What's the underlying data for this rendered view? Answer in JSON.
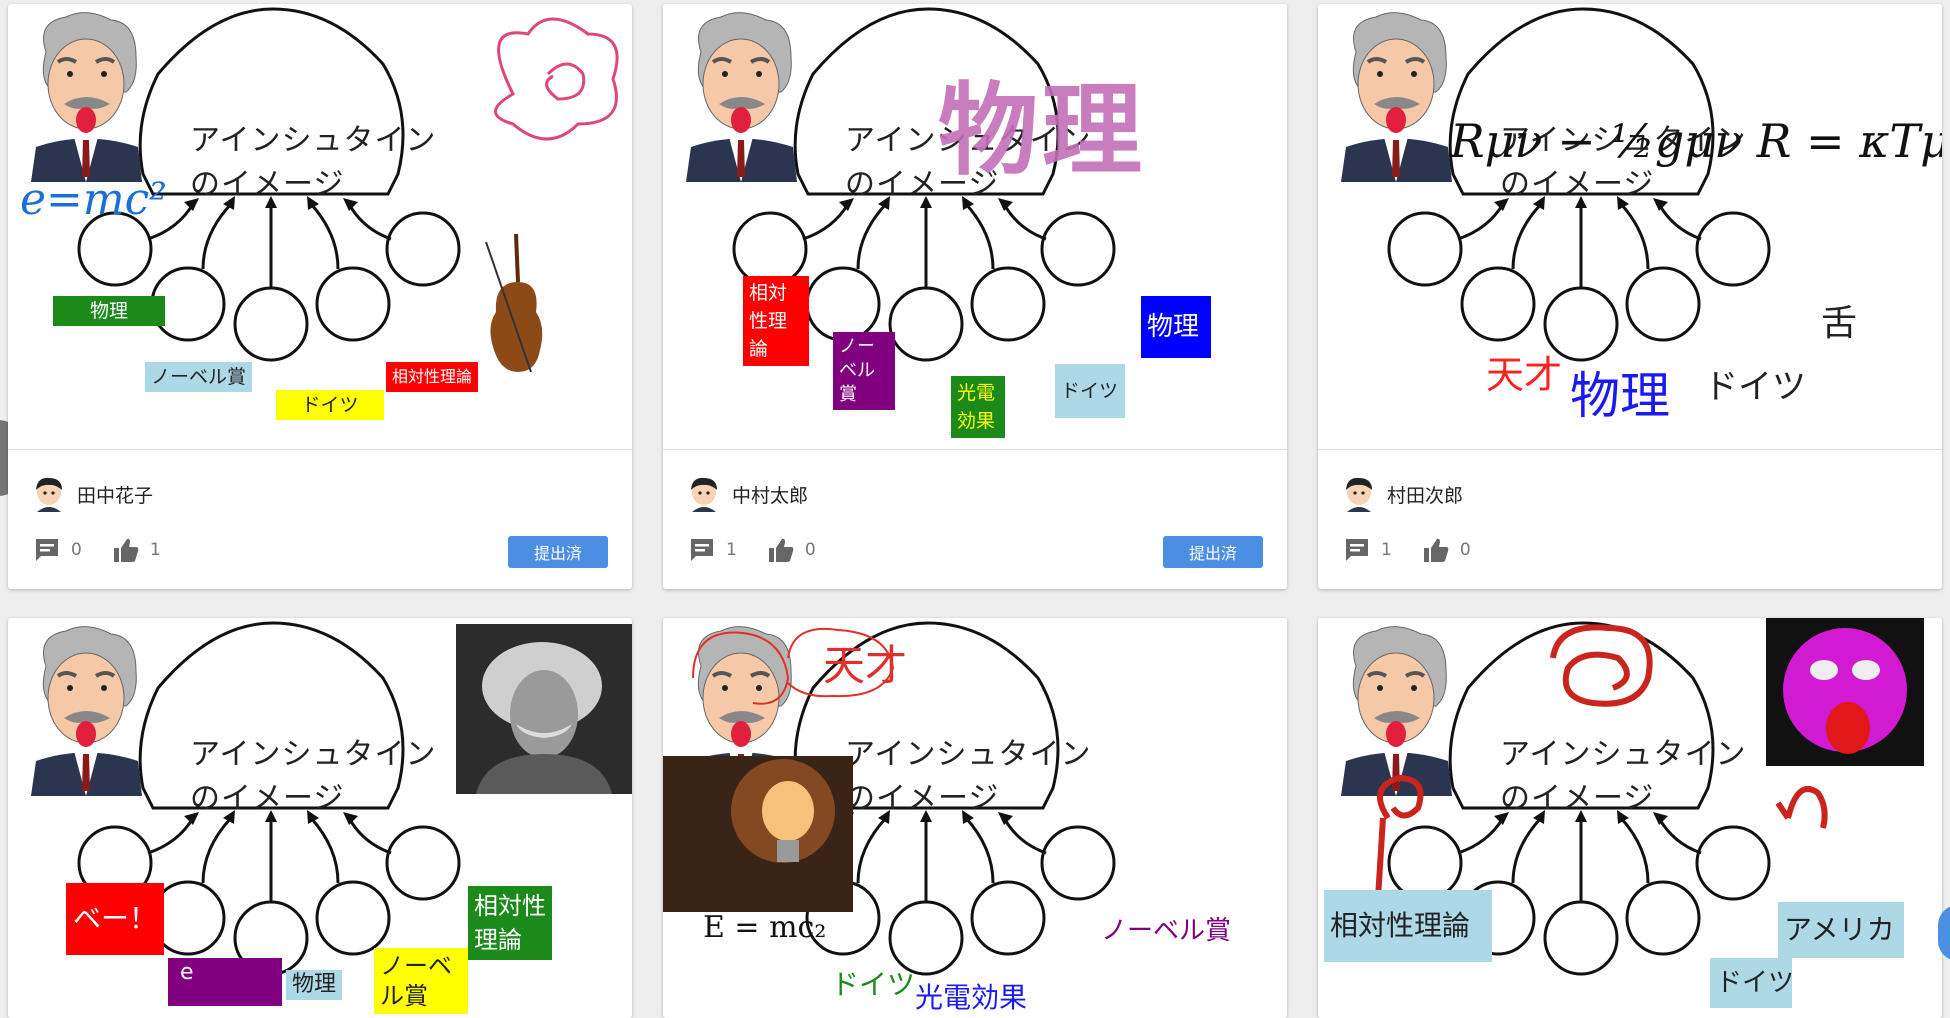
{
  "bubble": {
    "line1": "アインシュタイン",
    "line2": "のイメージ"
  },
  "cards": [
    {
      "author": "田中花子",
      "comments": "0",
      "likes": "1",
      "status": "提出済",
      "tags": [
        "物理",
        "ノーベル賞",
        "ドイツ",
        "相対性理論"
      ],
      "ink": "e=mc²"
    },
    {
      "author": "中村太郎",
      "comments": "1",
      "likes": "0",
      "status": "提出済",
      "tags": [
        "相対性理論",
        "ノーベル賞",
        "光電効果",
        "ドイツ",
        "物理"
      ],
      "stamp": "物理"
    },
    {
      "author": "村田次郎",
      "comments": "1",
      "likes": "0",
      "status": "",
      "equation": "Rμν − ½gμν R = κTμν",
      "words": [
        "天才",
        "物理",
        "ドイツ",
        "舌"
      ]
    },
    {
      "tags": [
        "ベー！",
        "e",
        "物理",
        "ノーベル賞",
        "相対性理論"
      ]
    },
    {
      "formula": "E = mc₂",
      "words": [
        "天才",
        "ノーベル賞",
        "ドイツ",
        "光電効果"
      ]
    },
    {
      "tags": [
        "相対性理論",
        "アメリカ",
        "ドイツ"
      ]
    }
  ],
  "icons": {
    "comment": "comment-icon",
    "like": "thumb-up-icon",
    "avatar": "boy-avatar-icon"
  },
  "colors": {
    "submit": "#4a8fe2",
    "background": "#eeeeee"
  }
}
